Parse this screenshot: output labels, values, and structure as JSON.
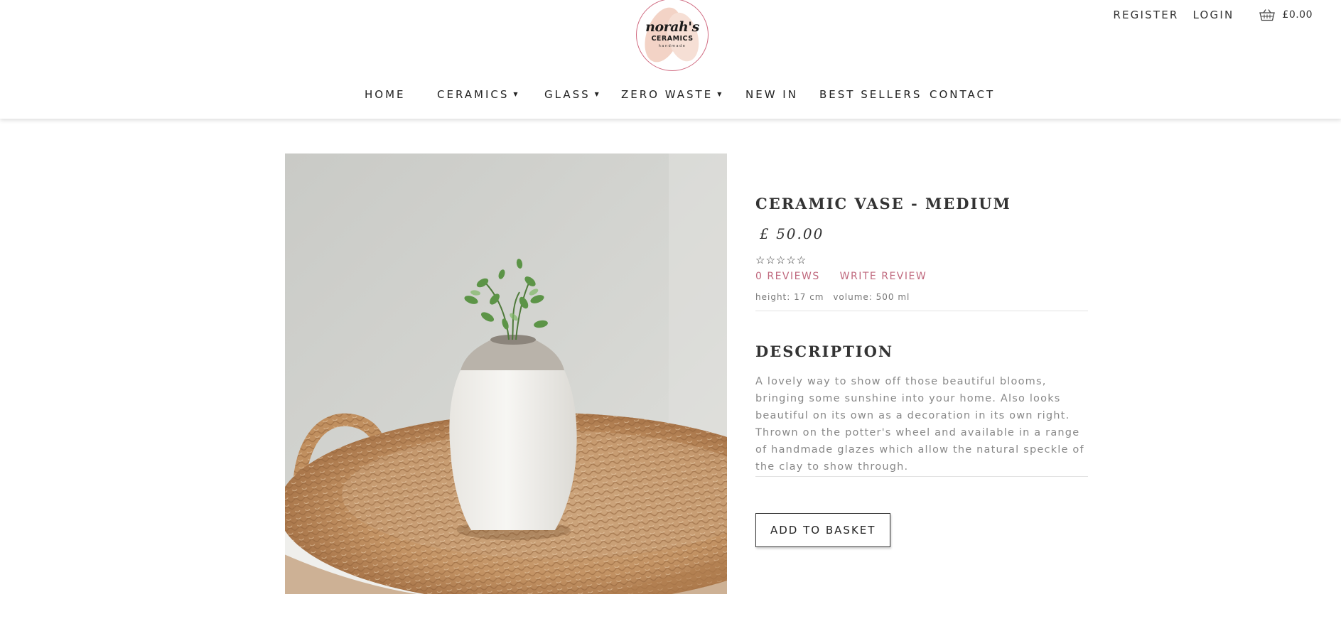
{
  "brand": {
    "name": "norah's",
    "subtitle": "CERAMICS",
    "tagline": "handmade"
  },
  "account": {
    "register_label": "REGISTER",
    "login_label": "LOGIN",
    "cart_total": "£0.00"
  },
  "nav": {
    "items": [
      {
        "label": "HOME",
        "has_dropdown": false
      },
      {
        "label": "CERAMICS",
        "has_dropdown": true
      },
      {
        "label": "GLASS",
        "has_dropdown": true
      },
      {
        "label": "ZERO WASTE",
        "has_dropdown": true
      },
      {
        "label": "NEW IN",
        "has_dropdown": false
      },
      {
        "label": "BEST SELLERS",
        "has_dropdown": false
      },
      {
        "label": "CONTACT",
        "has_dropdown": false
      }
    ],
    "dropdown_glyph": "▼"
  },
  "product": {
    "title": "CERAMIC VASE - MEDIUM",
    "price": "£ 50.00",
    "rating_stars": "☆☆☆☆☆",
    "rating": 0,
    "reviews_label": "0 REVIEWS",
    "write_review_label": "WRITE REVIEW",
    "height_spec": "height: 17 cm",
    "volume_spec": "volume: 500 ml",
    "description_heading": "DESCRIPTION",
    "description": "A lovely way to show off those beautiful blooms, bringing some sunshine into your home. Also looks beautiful on its own as a decoration in its own right. Thrown on the potter's wheel and available in a range of handmade glazes which allow the natural speckle of the clay to show through.",
    "add_to_basket_label": "ADD TO BASKET"
  },
  "colors": {
    "accent_pink": "#c0697e",
    "logo_border": "#d06a80",
    "text_dark": "#333333",
    "text_muted": "#888888"
  }
}
